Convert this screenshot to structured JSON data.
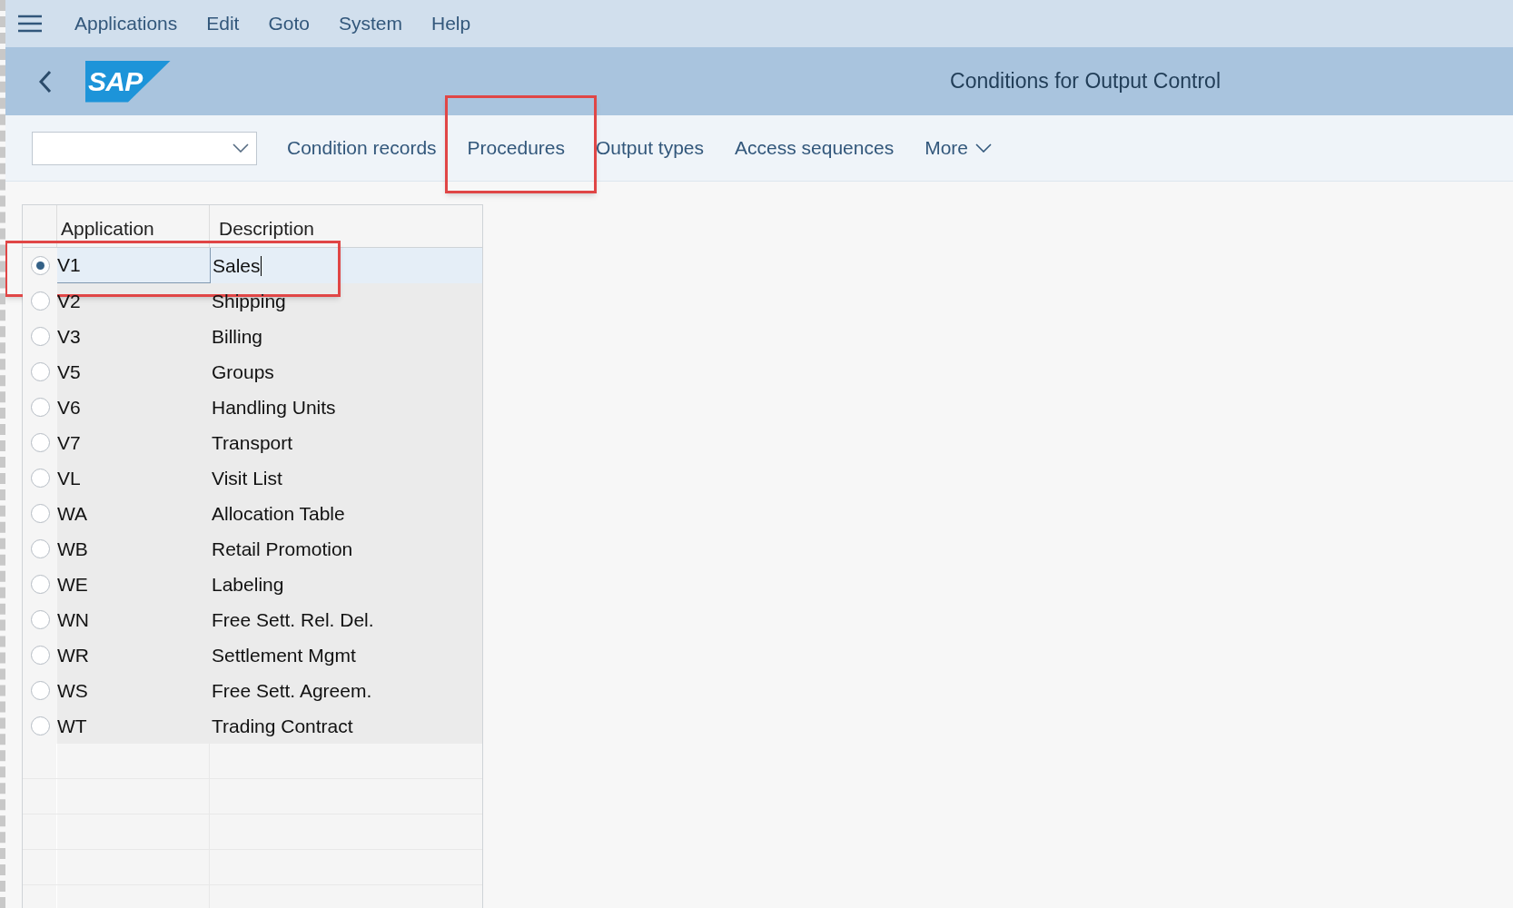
{
  "menu": [
    "Applications",
    "Edit",
    "Goto",
    "System",
    "Help"
  ],
  "header": {
    "title": "Conditions for Output Control",
    "logo": "SAP"
  },
  "toolbar": {
    "items": [
      {
        "label": "Condition records",
        "annotated": false
      },
      {
        "label": "Procedures",
        "annotated": true
      },
      {
        "label": "Output types",
        "annotated": false
      },
      {
        "label": "Access sequences",
        "annotated": false
      },
      {
        "label": "More",
        "annotated": false,
        "kind": "menu"
      }
    ]
  },
  "table": {
    "columns": [
      "Application",
      "Description"
    ],
    "rows": [
      {
        "application": "V1",
        "description": "Sales",
        "selected": true,
        "annotated": true
      },
      {
        "application": "V2",
        "description": "Shipping",
        "selected": false,
        "annotated": false
      },
      {
        "application": "V3",
        "description": "Billing",
        "selected": false,
        "annotated": false
      },
      {
        "application": "V5",
        "description": "Groups",
        "selected": false,
        "annotated": false
      },
      {
        "application": "V6",
        "description": "Handling Units",
        "selected": false,
        "annotated": false
      },
      {
        "application": "V7",
        "description": "Transport",
        "selected": false,
        "annotated": false
      },
      {
        "application": "VL",
        "description": "Visit List",
        "selected": false,
        "annotated": false
      },
      {
        "application": "WA",
        "description": "Allocation Table",
        "selected": false,
        "annotated": false
      },
      {
        "application": "WB",
        "description": "Retail Promotion",
        "selected": false,
        "annotated": false
      },
      {
        "application": "WE",
        "description": "Labeling",
        "selected": false,
        "annotated": false
      },
      {
        "application": "WN",
        "description": "Free Sett. Rel. Del.",
        "selected": false,
        "annotated": false
      },
      {
        "application": "WR",
        "description": "Settlement Mgmt",
        "selected": false,
        "annotated": false
      },
      {
        "application": "WS",
        "description": "Free Sett. Agreem.",
        "selected": false,
        "annotated": false
      },
      {
        "application": "WT",
        "description": "Trading Contract",
        "selected": false,
        "annotated": false
      }
    ]
  }
}
